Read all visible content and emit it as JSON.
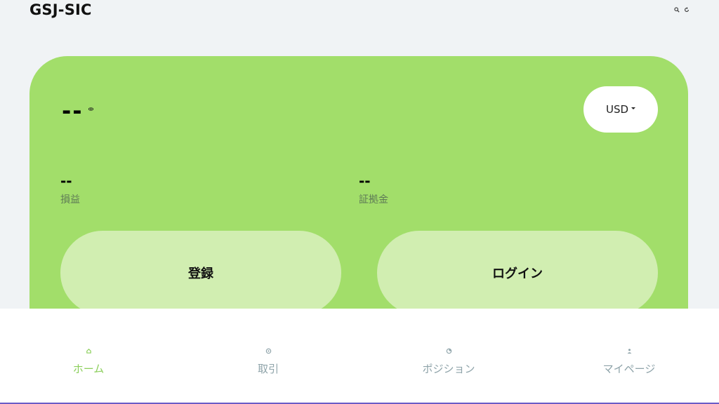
{
  "header": {
    "brand": "GSJ-SIC",
    "icons": [
      "search-icon",
      "refresh-icon"
    ]
  },
  "account_card": {
    "balance": "--",
    "currency": "USD",
    "metrics": [
      {
        "value": "--",
        "label": "損益"
      },
      {
        "value": "--",
        "label": "証拠金"
      }
    ],
    "register_label": "登録",
    "login_label": "ログイン"
  },
  "bottom_nav": {
    "items": [
      {
        "label": "ホーム",
        "icon": "home-icon",
        "active": true
      },
      {
        "label": "取引",
        "icon": "trade-icon",
        "active": false
      },
      {
        "label": "ポジション",
        "icon": "position-icon",
        "active": false
      },
      {
        "label": "マイページ",
        "icon": "user-icon",
        "active": false
      }
    ]
  },
  "colors": {
    "card": "#a2de6a",
    "button": "#d1eeb1",
    "active_nav": "#8ccf5c",
    "inactive_nav": "#8ea3a9",
    "background": "#f0f3f5"
  }
}
